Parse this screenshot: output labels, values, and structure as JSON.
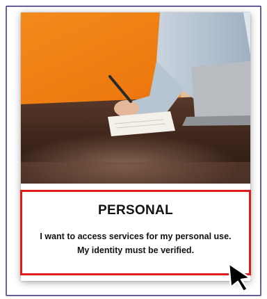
{
  "card": {
    "title": "PERSONAL",
    "description": "I want to access services for my personal use. My identity must be verified."
  },
  "photo": {
    "subject": "person writing in notebook at desk with laptop",
    "wall_color": "#f07f12",
    "desk_color": "#4a2d22"
  },
  "highlight_color": "#e01b1b",
  "icons": [
    "mouse-pointer-icon"
  ]
}
